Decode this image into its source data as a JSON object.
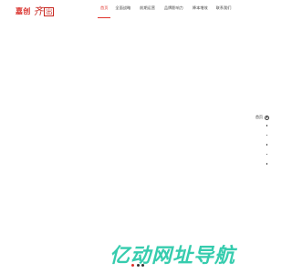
{
  "header": {
    "logo": {
      "brand_cn": "嘉创",
      "script": "齐",
      "script_boxed": "出"
    },
    "nav": [
      {
        "label": "首页",
        "active": true
      },
      {
        "label": "全面战略",
        "active": false
      },
      {
        "label": "前期运营",
        "active": false
      },
      {
        "label": "品牌影响力",
        "active": false
      },
      {
        "label": "降本增效",
        "active": false
      },
      {
        "label": "联系我们",
        "active": false
      }
    ]
  },
  "side_nav": {
    "current_label": "首页",
    "dot_count": 5
  },
  "watermark": {
    "text": "亿动网址导航"
  },
  "slider": {
    "dot_count": 3,
    "active_index": 0
  },
  "colors": {
    "accent": "#e0312a",
    "watermark": "#13c4a0"
  }
}
